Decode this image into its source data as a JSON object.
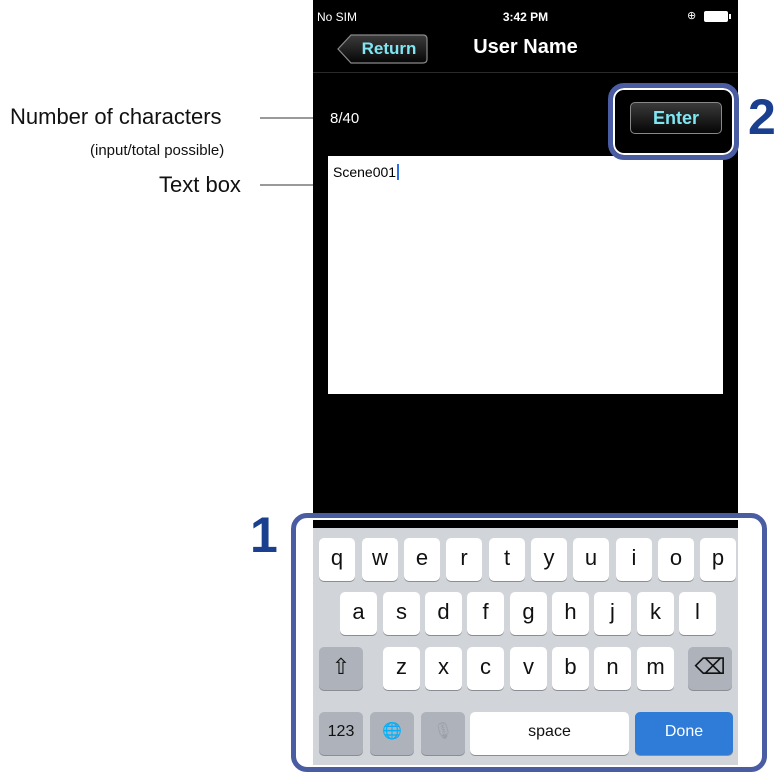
{
  "annotations": {
    "chars_label": "Number of characters",
    "chars_sublabel": "(input/total possible)",
    "textbox_label": "Text box",
    "callout_1": "1",
    "callout_2": "2"
  },
  "status_bar": {
    "carrier": "No SIM",
    "time": "3:42 PM",
    "icons": [
      "rotation-lock-icon",
      "battery-icon"
    ]
  },
  "nav": {
    "return_label": "Return",
    "title": "User Name"
  },
  "char_count": "8/40",
  "enter_label": "Enter",
  "textbox": {
    "value": "Scene001"
  },
  "keyboard": {
    "row1": [
      "q",
      "w",
      "e",
      "r",
      "t",
      "y",
      "u",
      "i",
      "o",
      "p"
    ],
    "row2": [
      "a",
      "s",
      "d",
      "f",
      "g",
      "h",
      "j",
      "k",
      "l"
    ],
    "row3": [
      "z",
      "x",
      "c",
      "v",
      "b",
      "n",
      "m"
    ],
    "shift_icon": "⇧",
    "backspace_icon": "⌫",
    "numbers_label": "123",
    "globe_icon": "🌐",
    "mic_icon": "🎙",
    "space_label": "space",
    "done_label": "Done"
  },
  "colors": {
    "accent_cyan": "#7fe6f2",
    "highlight_blue": "#4a5ca2",
    "callout_blue": "#1a3f8f",
    "done_blue": "#2f7bd8"
  }
}
